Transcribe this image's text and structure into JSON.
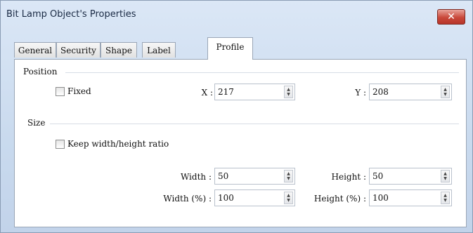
{
  "window": {
    "title": "Bit Lamp Object's Properties",
    "close_glyph": "✕"
  },
  "tabs": [
    {
      "label": "General"
    },
    {
      "label": "Security"
    },
    {
      "label": "Shape"
    },
    {
      "label": "Label"
    },
    {
      "label": "Profile",
      "active": true
    }
  ],
  "position": {
    "group_label": "Position",
    "fixed_label": "Fixed",
    "fixed_checked": false,
    "x_label": "X :",
    "x_value": "217",
    "y_label": "Y :",
    "y_value": "208"
  },
  "size": {
    "group_label": "Size",
    "keep_ratio_label": "Keep width/height ratio",
    "keep_ratio_checked": false,
    "width_label": "Width :",
    "width_value": "50",
    "height_label": "Height :",
    "height_value": "50",
    "width_pct_label": "Width (%) :",
    "width_pct_value": "100",
    "height_pct_label": "Height (%) :",
    "height_pct_value": "100"
  }
}
